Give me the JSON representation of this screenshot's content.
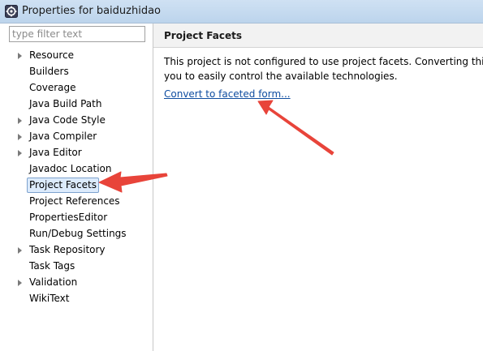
{
  "window": {
    "title": "Properties for baiduzhidao"
  },
  "filter": {
    "placeholder": "type filter text",
    "value": ""
  },
  "tree": {
    "items": [
      {
        "label": "Resource",
        "expandable": true
      },
      {
        "label": "Builders",
        "expandable": false
      },
      {
        "label": "Coverage",
        "expandable": false
      },
      {
        "label": "Java Build Path",
        "expandable": false
      },
      {
        "label": "Java Code Style",
        "expandable": true
      },
      {
        "label": "Java Compiler",
        "expandable": true
      },
      {
        "label": "Java Editor",
        "expandable": true
      },
      {
        "label": "Javadoc Location",
        "expandable": false
      },
      {
        "label": "Project Facets",
        "expandable": false,
        "selected": true
      },
      {
        "label": "Project References",
        "expandable": false
      },
      {
        "label": "PropertiesEditor",
        "expandable": false
      },
      {
        "label": "Run/Debug Settings",
        "expandable": false
      },
      {
        "label": "Task Repository",
        "expandable": true
      },
      {
        "label": "Task Tags",
        "expandable": false
      },
      {
        "label": "Validation",
        "expandable": true
      },
      {
        "label": "WikiText",
        "expandable": false
      }
    ]
  },
  "page": {
    "title": "Project Facets",
    "description_line1": "This project is not configured to use project facets. Converting this",
    "description_line2": "you to easily control the available technologies.",
    "convert_link": "Convert to faceted form..."
  },
  "colors": {
    "annotation_arrow": "#e8443a",
    "link": "#0f4da0",
    "selection_bg": "#dcebfc",
    "selection_border": "#7da2ce"
  },
  "icons": {
    "app": "eclipse-gear-icon",
    "expand": "triangle-right-icon"
  }
}
